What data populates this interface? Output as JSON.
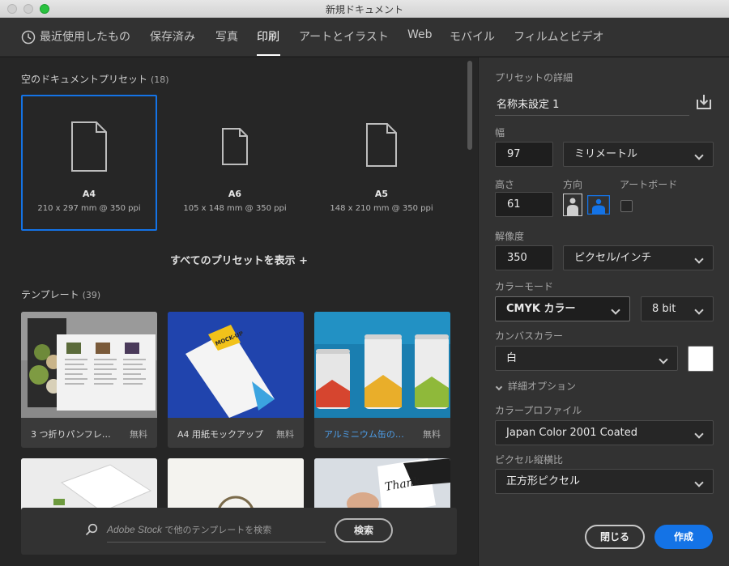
{
  "window": {
    "title": "新規ドキュメント"
  },
  "tabs": [
    {
      "label": "最近使用したもの"
    },
    {
      "label": "保存済み"
    },
    {
      "label": "写真"
    },
    {
      "label": "印刷"
    },
    {
      "label": "アートとイラスト"
    },
    {
      "label": "Web"
    },
    {
      "label": "モバイル"
    },
    {
      "label": "フィルムとビデオ"
    }
  ],
  "active_tab": "印刷",
  "blank_presets": {
    "heading": "空のドキュメントプリセット",
    "count": "(18)",
    "items": [
      {
        "name": "A4",
        "dims": "210 x 297 mm @ 350 ppi",
        "selected": true
      },
      {
        "name": "A6",
        "dims": "105 x 148 mm @ 350 ppi",
        "selected": false
      },
      {
        "name": "A5",
        "dims": "148 x 210 mm @ 350 ppi",
        "selected": false
      }
    ],
    "show_all": "すべてのプリセットを表示 +"
  },
  "templates": {
    "heading": "テンプレート",
    "count": "(39)",
    "items": [
      {
        "title": "3 つ折りパンフレ…",
        "price": "無料"
      },
      {
        "title": "A4 用紙モックアップ",
        "price": "無料"
      },
      {
        "title": "アルミニウム缶の…",
        "price": "無料"
      }
    ],
    "thumb_texts": {
      "mockup": "MOCK-UP",
      "handwriting": "Thank"
    }
  },
  "stock_search": {
    "placeholder_brand": "Adobe Stock",
    "placeholder_rest": " で他のテンプレートを検索",
    "button": "検索"
  },
  "details": {
    "heading": "プリセットの詳細",
    "name": "名称未設定 1",
    "width_label": "幅",
    "width_value": "97",
    "unit": "ミリメートル",
    "height_label": "高さ",
    "height_value": "61",
    "orientation_label": "方向",
    "artboard_label": "アートボード",
    "resolution_label": "解像度",
    "resolution_value": "350",
    "resolution_unit": "ピクセル/インチ",
    "color_mode_label": "カラーモード",
    "color_mode": "CMYK カラー",
    "bit_depth": "8 bit",
    "canvas_color_label": "カンバスカラー",
    "canvas_color": "白",
    "canvas_swatch": "#ffffff",
    "advanced_label": "詳細オプション",
    "profile_label": "カラープロファイル",
    "profile": "Japan Color 2001 Coated",
    "pixel_aspect_label": "ピクセル縦横比",
    "pixel_aspect": "正方形ピクセル"
  },
  "actions": {
    "close": "閉じる",
    "create": "作成"
  },
  "colors": {
    "accent": "#1473e6",
    "link": "#4d9ee9"
  }
}
